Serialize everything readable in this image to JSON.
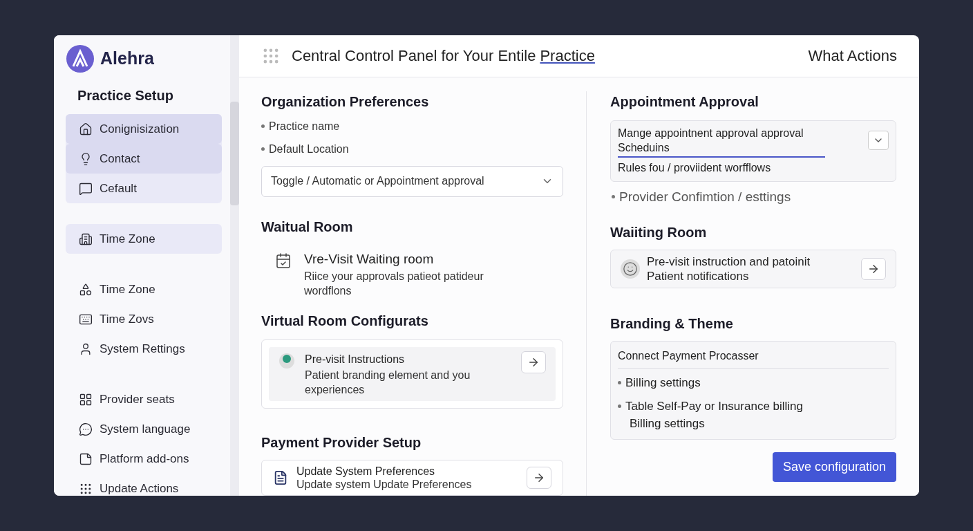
{
  "brand": {
    "name": "Alehra"
  },
  "sidebar": {
    "title": "Practice Setup",
    "groups": [
      {
        "highlighted": true,
        "items": [
          {
            "label": "Conignisization",
            "selected": true
          },
          {
            "label": "Contact",
            "selected": true
          },
          {
            "label": "Cefault",
            "selected": false
          }
        ]
      },
      {
        "highlighted": true,
        "items": [
          {
            "label": "Time Zone",
            "selected": false
          }
        ]
      },
      {
        "highlighted": false,
        "items": [
          {
            "label": "Time Zone",
            "selected": false
          },
          {
            "label": "Time Zovs",
            "selected": false
          },
          {
            "label": "System Rettings",
            "selected": false
          }
        ]
      },
      {
        "highlighted": false,
        "items": [
          {
            "label": "Provider seats",
            "selected": false
          },
          {
            "label": "System language",
            "selected": false
          },
          {
            "label": "Platform add-ons",
            "selected": false
          },
          {
            "label": "Update Actions",
            "selected": false
          }
        ]
      }
    ]
  },
  "header": {
    "title": "Central Control Panel for Your Entile",
    "link": "Practice",
    "action": "What Actions"
  },
  "left": {
    "organization": {
      "title": "Organization Preferences",
      "bullets": [
        "Practice name",
        "Default Location"
      ],
      "select": "Toggle / Automatic or Appointment approval"
    },
    "waiting": {
      "title": "Waitual Room",
      "item_title": "Vre-Visit Waiting room",
      "item_desc": "Riice your approvals patieot patideur wordflons"
    },
    "virtual": {
      "title": "Virtual Room Configurats",
      "item_title": "Pre-visit Instructions",
      "item_desc": "Patient branding element and you experiences"
    },
    "payment": {
      "title": "Payment Provider Setup",
      "item_title": "Update System Preferences",
      "item_desc": "Update system Update Preferences"
    }
  },
  "right": {
    "approval": {
      "title": "Appointment Approval",
      "line1": "Mange appointnent approval approval Scheduins",
      "line2": "Rules fou / proviident worfflows",
      "bullet": "Provider Confimtion / esttings"
    },
    "waiting": {
      "title": "Waiiting Room",
      "line1": "Pre-visit instruction and patoinit",
      "line2": "Patient notifications"
    },
    "branding": {
      "title": "Branding & Theme",
      "heading": "Connect Payment Procasser",
      "bullets": [
        "Billing settings",
        "Table Self-Pay or Insurance billing"
      ],
      "sub": "Billing settings"
    },
    "save": "Save configuration"
  }
}
